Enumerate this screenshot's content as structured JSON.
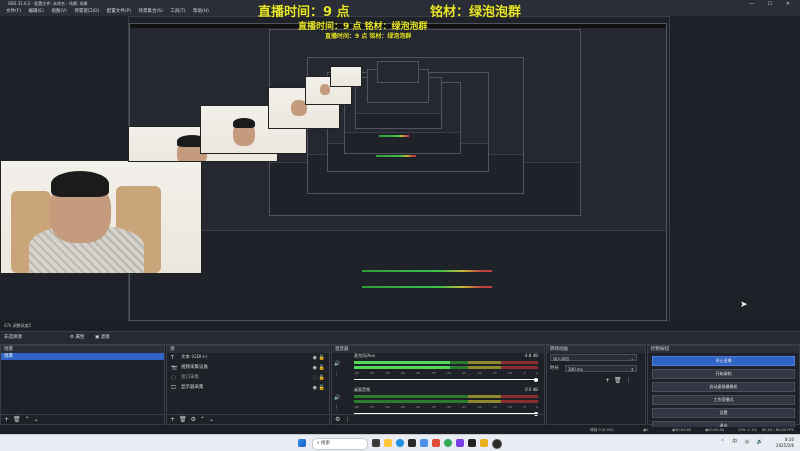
{
  "window": {
    "title": "OBS 31.0.2 - 配置文件: 未命名 - 场景: 场景",
    "controls": "— ☐ ✕"
  },
  "menu": {
    "items": [
      "文件(F)",
      "编辑(E)",
      "视图(V)",
      "停靠窗口(D)",
      "配置文件(P)",
      "场景集合(S)",
      "工具(T)",
      "帮助(H)"
    ]
  },
  "overlay": {
    "line1_left": "直播时间：9 点",
    "line1_right": "铭材：绿泡泡群",
    "line2": "直播时间：9 点   铭材：绿泡泡群"
  },
  "statusline": {
    "text": "07k 调整高度5"
  },
  "dock_strip": {
    "label": "非选择源",
    "props_btn": "属性",
    "filters_btn": "滤镜"
  },
  "scenes": {
    "header": "场景",
    "items": [
      {
        "label": "场景",
        "active": true
      }
    ]
  },
  "sources": {
    "header": "源",
    "items": [
      {
        "label": "文本 (GDI+)",
        "icon": "text-icon"
      },
      {
        "label": "视频采集设备",
        "icon": "camera-icon"
      },
      {
        "label": "窗口采集",
        "icon": "window-icon"
      },
      {
        "label": "显示器采集",
        "icon": "monitor-icon"
      }
    ]
  },
  "mixer": {
    "header": "混音器",
    "channels": [
      {
        "name": "麦克风/Aux",
        "db": "-4.8 dB",
        "level": 0.52,
        "volume": 1.0
      },
      {
        "name": "桌面音频",
        "db": "0.0 dB",
        "level": 0.0,
        "volume": 1.0
      }
    ],
    "scale": [
      "-60",
      "-55",
      "-50",
      "-45",
      "-40",
      "-35",
      "-30",
      "-25",
      "-20",
      "-15",
      "-10",
      "-5",
      "0"
    ]
  },
  "transitions": {
    "header": "转场动画",
    "type_value": "淡入淡出",
    "duration_label": "时长",
    "duration_value": "300 ms"
  },
  "controls": {
    "header": "控制按钮",
    "buttons": [
      "停止直播",
      "开始录制",
      "启动虚拟摄像机",
      "工作室模式",
      "设置",
      "退出"
    ]
  },
  "stats": {
    "dropped": "掉帧 0 (0.0%)",
    "bitrate": "0 kbps",
    "live_time": "00:00:00",
    "rec_time": "00:00:00",
    "cpu": "CPU: 1.1%",
    "fps": "60.00 / 60.00 FPS"
  },
  "taskbar": {
    "search_placeholder": "搜索",
    "time": "8:10",
    "date": "2025/2/6"
  },
  "colors": {
    "accent": "#2f63c5",
    "overlay_text": "#e9e82b",
    "meter_green": "#4fd957"
  }
}
